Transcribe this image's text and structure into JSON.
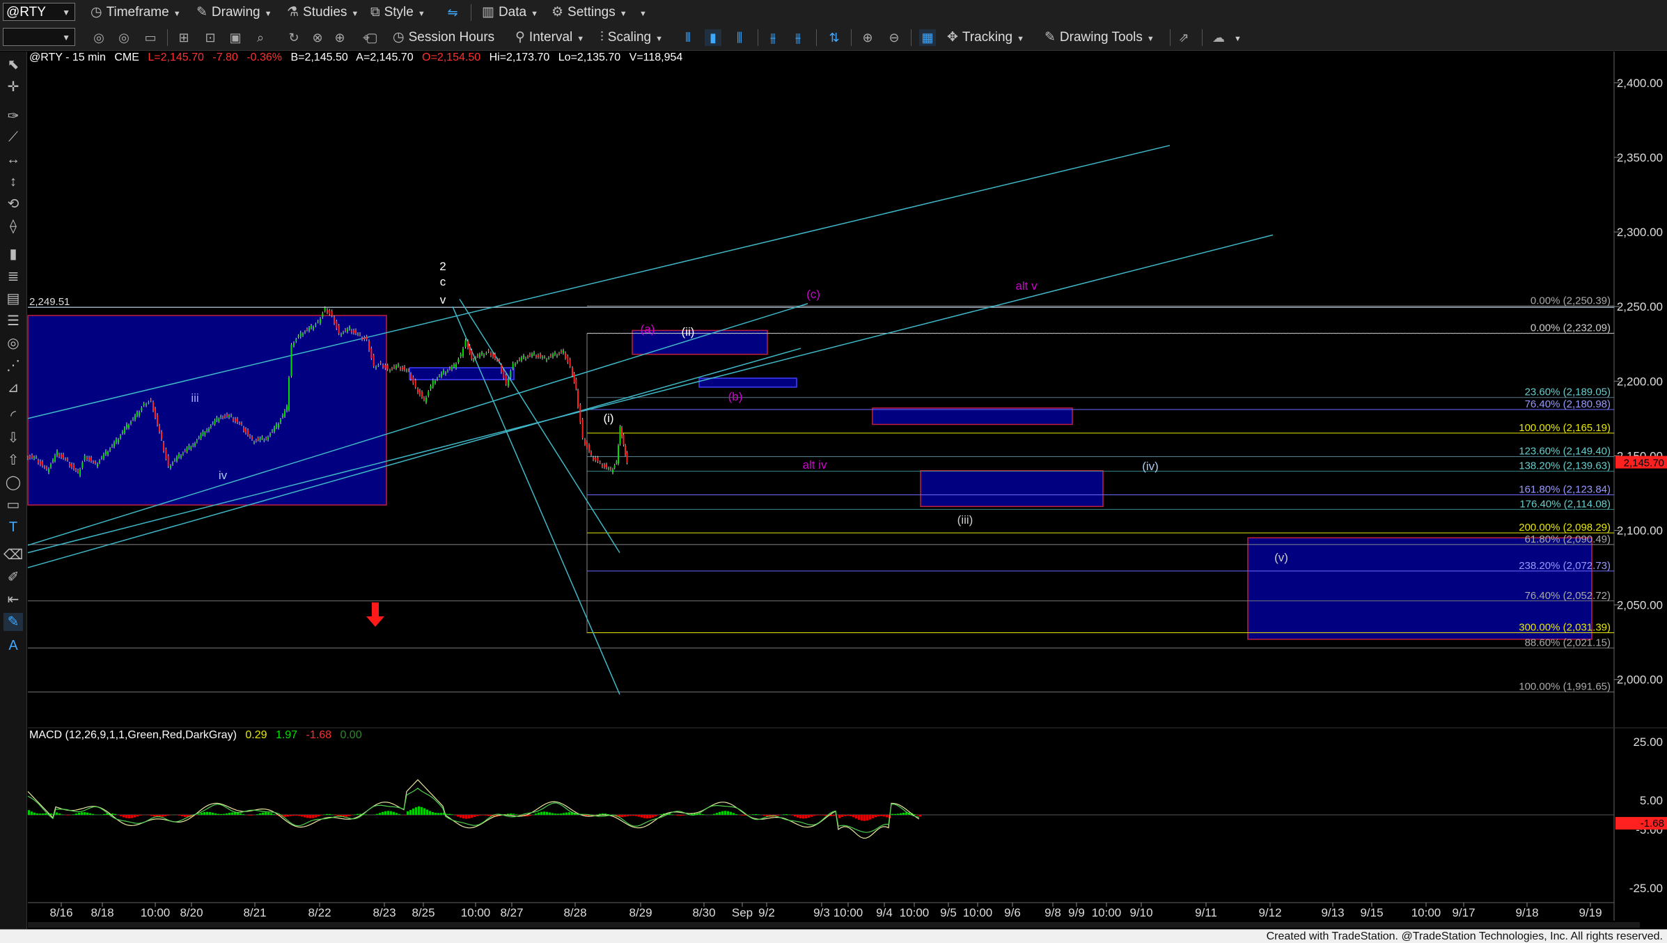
{
  "toolbar1": {
    "symbol": "@RTY",
    "timeframe": "Timeframe",
    "drawing": "Drawing",
    "studies": "Studies",
    "style": "Style",
    "data": "Data",
    "settings": "Settings"
  },
  "toolbar2": {
    "session_hours": "Session Hours",
    "interval": "Interval",
    "scaling": "Scaling",
    "tracking": "Tracking",
    "drawing_tools": "Drawing Tools"
  },
  "title": {
    "symbol": "@RTY - 15 min",
    "exchange": "CME",
    "last": "L=2,145.70",
    "change": "-7.80",
    "pct": "-0.36%",
    "bid": "B=2,145.50",
    "ask": "A=2,145.70",
    "open": "O=2,154.50",
    "high": "Hi=2,173.70",
    "low": "Lo=2,135.70",
    "volume": "V=118,954"
  },
  "macd": {
    "label": "MACD (12,26,9,1,1,Green,Red,DarkGray)",
    "v1": "0.29",
    "v2": "1.97",
    "v3": "-1.68",
    "v4": "0.00",
    "axis_ticks": [
      "25.00",
      "5.00",
      "-5.00",
      "-25.00"
    ],
    "last_tag": "-1.68"
  },
  "colors": {
    "bg": "#000000",
    "up": "#00e000",
    "down": "#ff2020",
    "channel": "#3fb8c8",
    "box": "#000080",
    "fib_yellow": "#e8e800",
    "wave_purple": "#c000c0"
  },
  "chart_data": {
    "type": "candlestick",
    "y_axis_ticks": [
      "2,400.00",
      "2,350.00",
      "2,300.00",
      "2,250.00",
      "2,200.00",
      "2,150.00",
      "2,100.00",
      "2,050.00",
      "2,000.00"
    ],
    "ylim": [
      1970,
      2420
    ],
    "price_marker": "2,145.70",
    "x_tick_labels": [
      "8/16",
      "8/18",
      "10:00",
      "8/20",
      "8/21",
      "8/22",
      "8/23",
      "8/25",
      "10:00",
      "8/27",
      "8/28",
      "8/29",
      "8/30",
      "Sep",
      "9/2",
      "9/3",
      "10:00",
      "9/4",
      "10:00",
      "9/5",
      "10:00",
      "9/6",
      "9/8",
      "9/9",
      "10:00",
      "9/10",
      "9/11",
      "9/12",
      "9/13",
      "9/15",
      "10:00",
      "9/17",
      "9/18",
      "9/19"
    ],
    "high_label": "2,249.51",
    "price_path": [
      [
        0,
        2150
      ],
      [
        15,
        2148
      ],
      [
        30,
        2140
      ],
      [
        45,
        2152
      ],
      [
        60,
        2146
      ],
      [
        75,
        2138
      ],
      [
        85,
        2150
      ],
      [
        100,
        2144
      ],
      [
        115,
        2152
      ],
      [
        130,
        2160
      ],
      [
        145,
        2170
      ],
      [
        160,
        2178
      ],
      [
        170,
        2185
      ],
      [
        180,
        2187
      ],
      [
        195,
        2160
      ],
      [
        205,
        2143
      ],
      [
        220,
        2150
      ],
      [
        240,
        2158
      ],
      [
        260,
        2168
      ],
      [
        280,
        2177
      ],
      [
        295,
        2176
      ],
      [
        310,
        2170
      ],
      [
        325,
        2160
      ],
      [
        345,
        2162
      ],
      [
        360,
        2170
      ],
      [
        375,
        2182
      ],
      [
        382,
        2225
      ],
      [
        395,
        2232
      ],
      [
        410,
        2236
      ],
      [
        420,
        2240
      ],
      [
        430,
        2249
      ],
      [
        440,
        2244
      ],
      [
        450,
        2232
      ],
      [
        465,
        2235
      ],
      [
        480,
        2230
      ],
      [
        490,
        2228
      ],
      [
        500,
        2210
      ],
      [
        510,
        2212
      ],
      [
        520,
        2208
      ],
      [
        535,
        2210
      ],
      [
        550,
        2206
      ],
      [
        560,
        2196
      ],
      [
        572,
        2187
      ],
      [
        585,
        2200
      ],
      [
        600,
        2206
      ],
      [
        615,
        2210
      ],
      [
        625,
        2218
      ],
      [
        632,
        2228
      ],
      [
        640,
        2215
      ],
      [
        655,
        2218
      ],
      [
        665,
        2220
      ],
      [
        680,
        2212
      ],
      [
        690,
        2198
      ],
      [
        700,
        2212
      ],
      [
        715,
        2216
      ],
      [
        730,
        2218
      ],
      [
        745,
        2215
      ],
      [
        760,
        2218
      ],
      [
        772,
        2220
      ],
      [
        782,
        2210
      ],
      [
        790,
        2195
      ],
      [
        800,
        2162
      ],
      [
        812,
        2150
      ],
      [
        825,
        2145
      ],
      [
        840,
        2140
      ],
      [
        848,
        2146
      ],
      [
        853,
        2170
      ],
      [
        858,
        2158
      ],
      [
        863,
        2146
      ]
    ],
    "fib_levels": [
      {
        "label": "0.00% (2,250.39)",
        "value": 2250.39,
        "color": "#888888"
      },
      {
        "label": "0.00% (2,232.09)",
        "value": 2232.09,
        "color": "#cccccc"
      },
      {
        "label": "23.60% (2,189.05)",
        "value": 2189.05,
        "color": "#5a7a8a"
      },
      {
        "label": "76.40% (2,180.98)",
        "value": 2180.98,
        "color": "#6a6aff"
      },
      {
        "label": "100.00% (2,165.19)",
        "value": 2165.19,
        "color": "#e8e800"
      },
      {
        "label": "123.60% (2,149.40)",
        "value": 2149.4,
        "color": "#5a8a9a"
      },
      {
        "label": "138.20% (2,139.63)",
        "value": 2139.63,
        "color": "#3a8a8a"
      },
      {
        "label": "161.80% (2,123.84)",
        "value": 2123.84,
        "color": "#6a6aff"
      },
      {
        "label": "176.40% (2,114.08)",
        "value": 2114.08,
        "color": "#3a8a8a"
      },
      {
        "label": "200.00% (2,098.29)",
        "value": 2098.29,
        "color": "#e8e800"
      },
      {
        "label": "61.80% (2,090.49)",
        "value": 2090.49,
        "color": "#888888"
      },
      {
        "label": "238.20% (2,072.73)",
        "value": 2072.73,
        "color": "#6a6aff"
      },
      {
        "label": "76.40% (2,052.72)",
        "value": 2052.72,
        "color": "#777777"
      },
      {
        "label": "300.00% (2,031.39)",
        "value": 2031.39,
        "color": "#e8e800"
      },
      {
        "label": "88.60% (2,021.15)",
        "value": 2021.15,
        "color": "#777777"
      },
      {
        "label": "100.00% (1,991.65)",
        "value": 1991.65,
        "color": "#777777"
      }
    ],
    "wave_labels": [
      {
        "text": "2",
        "color": "#ffffff"
      },
      {
        "text": "c",
        "color": "#ffffff"
      },
      {
        "text": "v",
        "color": "#ffffff"
      },
      {
        "text": "iii",
        "color": "#aaaaff"
      },
      {
        "text": "iv",
        "color": "#aaccee"
      },
      {
        "text": "(a)",
        "color": "#d000d0"
      },
      {
        "text": "(ii)",
        "color": "#ffffff"
      },
      {
        "text": "(c)",
        "color": "#d000d0"
      },
      {
        "text": "(b)",
        "color": "#d000d0"
      },
      {
        "text": "(i)",
        "color": "#ffffff"
      },
      {
        "text": "alt iv",
        "color": "#d000d0"
      },
      {
        "text": "alt v",
        "color": "#d000d0"
      },
      {
        "text": "(iv)",
        "color": "#aaccee"
      },
      {
        "text": "(iii)",
        "color": "#cccccc"
      },
      {
        "text": "(v)",
        "color": "#cccccc"
      }
    ]
  },
  "credit": "Created with TradeStation. @TradeStation Technologies, Inc. All rights reserved."
}
